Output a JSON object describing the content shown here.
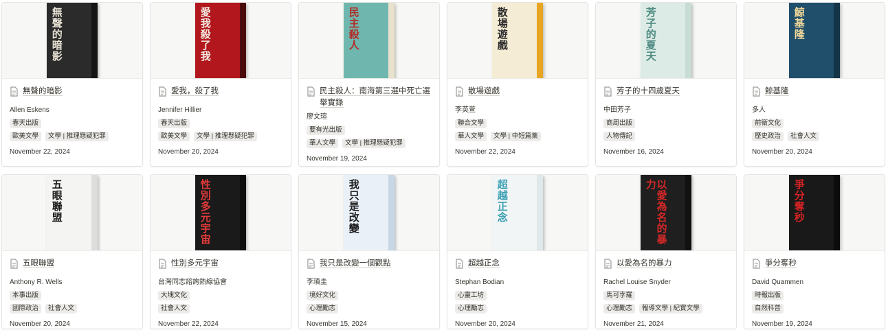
{
  "books": [
    {
      "title": "無聲的暗影",
      "author": "Allen Eskens",
      "publisher": "春天出版",
      "categories": [
        "歐美文學",
        "文學 | 推理懸疑犯罪"
      ],
      "date": "November 22, 2024",
      "cover": {
        "bg": "#2b2b2b",
        "fg": "#e8e2d4",
        "spine": "#141414",
        "text": "無聲的暗影"
      }
    },
    {
      "title": "愛我，殺了我",
      "author": "Jennifer Hillier",
      "publisher": "春天出版",
      "categories": [
        "歐美文學",
        "文學 | 推理懸疑犯罪"
      ],
      "date": "November 20, 2024",
      "cover": {
        "bg": "#b1171c",
        "fg": "#f3e8e0",
        "spine": "#4a0a0c",
        "text": "愛我殺了我"
      }
    },
    {
      "title": "民主殺人：南海第三選中死亡選舉實錄",
      "author": "廖文瑄",
      "publisher": "要有光出版",
      "categories": [
        "華人文學",
        "文學 | 推理懸疑犯罪"
      ],
      "date": "November 19, 2024",
      "cover": {
        "bg": "#6fb7ae",
        "fg": "#b42a24",
        "spine": "#e8e1cc",
        "text": "民主殺人"
      }
    },
    {
      "title": "散場遊戲",
      "author": "李英萱",
      "publisher": "聯合文學",
      "categories": [
        "華人文學",
        "文學 | 中短篇集"
      ],
      "date": "November 22, 2024",
      "cover": {
        "bg": "#f5ecd5",
        "fg": "#2a2a2a",
        "spine": "#e8a523",
        "text": "散場遊戲"
      }
    },
    {
      "title": "芳子的十四歲夏天",
      "author": "中田芳子",
      "publisher": "商周出版",
      "categories": [
        "人物傳記"
      ],
      "date": "November 16, 2024",
      "cover": {
        "bg": "#dcebe6",
        "fg": "#4d8a80",
        "spine": "#c7ddd6",
        "text": "芳子的夏天"
      }
    },
    {
      "title": "鯨基隆",
      "author": "多人",
      "publisher": "前衛文化",
      "categories": [
        "歷史政治",
        "社會人文"
      ],
      "date": "November 20, 2024",
      "cover": {
        "bg": "#1f4f6b",
        "fg": "#f0d89a",
        "spine": "#143447",
        "text": "鯨基隆"
      }
    },
    {
      "title": "五眼聯盟",
      "author": "Anthony R. Wells",
      "publisher": "本事出版",
      "categories": [
        "國際政治",
        "社會人文"
      ],
      "date": "November 20, 2024",
      "cover": {
        "bg": "#f4f4f2",
        "fg": "#1b1b1b",
        "spine": "#dddddd",
        "text": "五眼聯盟"
      }
    },
    {
      "title": "性別多元宇宙",
      "author": "台灣同志諮詢熱線協會",
      "publisher": "大塊文化",
      "categories": [
        "社會人文"
      ],
      "date": "November 22, 2024",
      "cover": {
        "bg": "#1a1a1a",
        "fg": "#e23a3a",
        "spine": "#0d0d0d",
        "text": "性別多元宇宙"
      }
    },
    {
      "title": "我只是改變一個觀點",
      "author": "李瑱圭",
      "publisher": "境好文化",
      "categories": [
        "心理勵志"
      ],
      "date": "November 15, 2024",
      "cover": {
        "bg": "#e9f0f7",
        "fg": "#1d1d1d",
        "spine": "#c9d6e5",
        "text": "我只是改變"
      }
    },
    {
      "title": "超越正念",
      "author": "Stephan Bodian",
      "publisher": "心靈工坊",
      "categories": [
        "心理勵志"
      ],
      "date": "November 20, 2024",
      "cover": {
        "bg": "#f2f5f6",
        "fg": "#3a9fb3",
        "spine": "#dfe8ea",
        "text": "超越正念"
      }
    },
    {
      "title": "以愛為名的暴力",
      "author": "Rachel Louise Snyder",
      "publisher": "馬可孛羅",
      "categories": [
        "心理勵志",
        "報導文學 | 紀實文學"
      ],
      "date": "November 21, 2024",
      "cover": {
        "bg": "#1f1f1f",
        "fg": "#d42828",
        "spine": "#111111",
        "text": "以愛為名的暴力"
      }
    },
    {
      "title": "爭分奪秒",
      "author": "David Quammen",
      "publisher": "時報出版",
      "categories": [
        "自然科普"
      ],
      "date": "November 19, 2024",
      "cover": {
        "bg": "#191919",
        "fg": "#d62323",
        "spine": "#0c0c0c",
        "text": "爭分奪秒"
      }
    }
  ]
}
